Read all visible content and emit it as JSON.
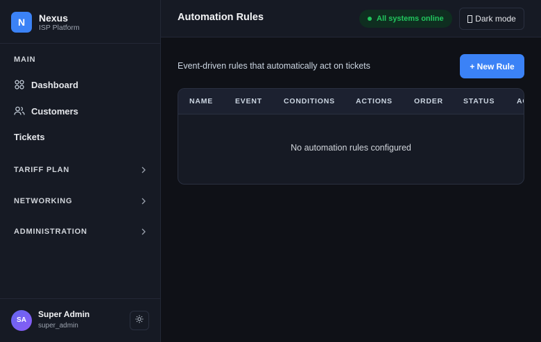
{
  "brand": {
    "initial": "N",
    "name": "Nexus",
    "subtitle": "ISP Platform"
  },
  "sidebar": {
    "section_label": "MAIN",
    "items": [
      {
        "label": "Dashboard",
        "icon": "grid-icon"
      },
      {
        "label": "Customers",
        "icon": "users-icon"
      },
      {
        "label": "Tickets"
      }
    ],
    "groups": [
      {
        "label": "TARIFF PLAN",
        "icon": "chevron-right-icon"
      },
      {
        "label": "NETWORKING",
        "icon": "chevron-right-icon"
      },
      {
        "label": "ADMINISTRATION",
        "icon": "chevron-right-icon"
      }
    ]
  },
  "user": {
    "initials": "SA",
    "name": "Super Admin",
    "handle": "super_admin"
  },
  "header": {
    "title": "Automation Rules",
    "status": "All systems online",
    "dark_mode_label": "Dark mode"
  },
  "main": {
    "description": "Event-driven rules that automatically act on tickets",
    "new_rule_label": "+ New Rule",
    "table": {
      "columns": [
        "NAME",
        "EVENT",
        "CONDITIONS",
        "ACTIONS",
        "ORDER",
        "STATUS",
        "AC"
      ],
      "empty_message": "No automation rules configured"
    }
  },
  "colors": {
    "accent": "#3b82f6",
    "success": "#22c55e",
    "background": "#0f1117",
    "panel": "#161a24"
  }
}
